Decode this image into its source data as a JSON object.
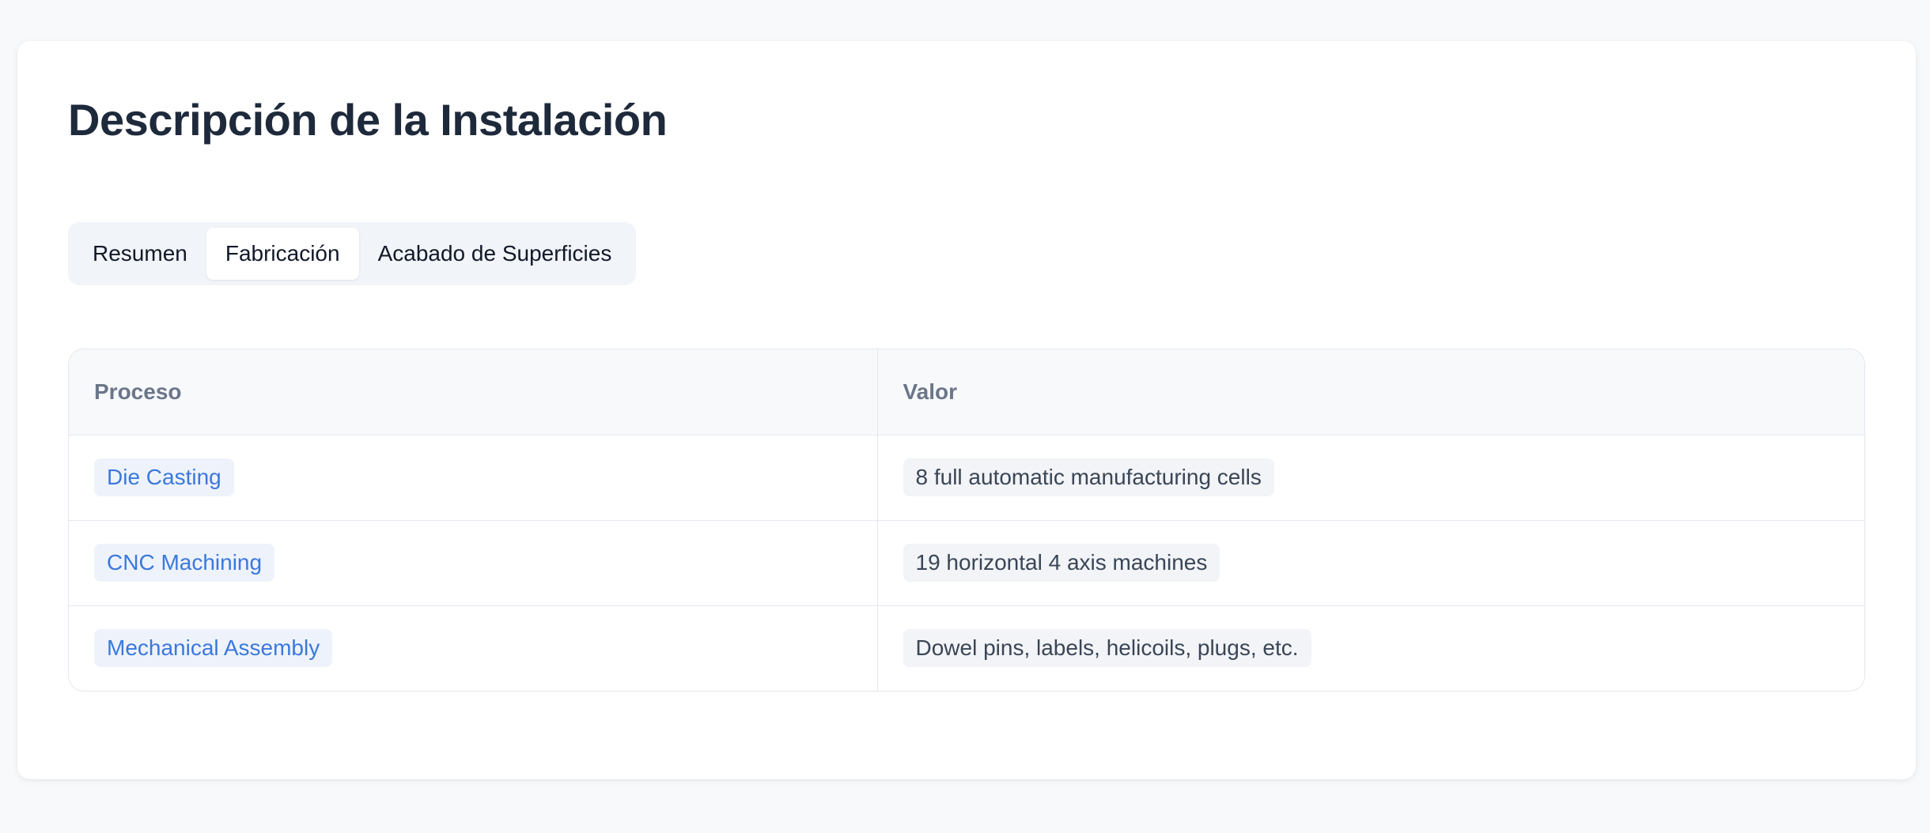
{
  "page": {
    "title": "Descripción de la Instalación"
  },
  "tabs": [
    {
      "label": "Resumen",
      "active": false
    },
    {
      "label": "Fabricación",
      "active": true
    },
    {
      "label": "Acabado de Superficies",
      "active": false
    }
  ],
  "table": {
    "headers": [
      "Proceso",
      "Valor"
    ],
    "rows": [
      {
        "process": "Die Casting",
        "value": "8 full automatic manufacturing cells"
      },
      {
        "process": "CNC Machining",
        "value": "19 horizontal 4 axis machines"
      },
      {
        "process": "Mechanical Assembly",
        "value": "Dowel pins, labels, helicoils, plugs, etc."
      }
    ]
  },
  "colors": {
    "background": "#f8f9fb",
    "card": "#ffffff",
    "title": "#1e2a3b",
    "link": "#3b78dd",
    "border": "#e3e7ee"
  }
}
